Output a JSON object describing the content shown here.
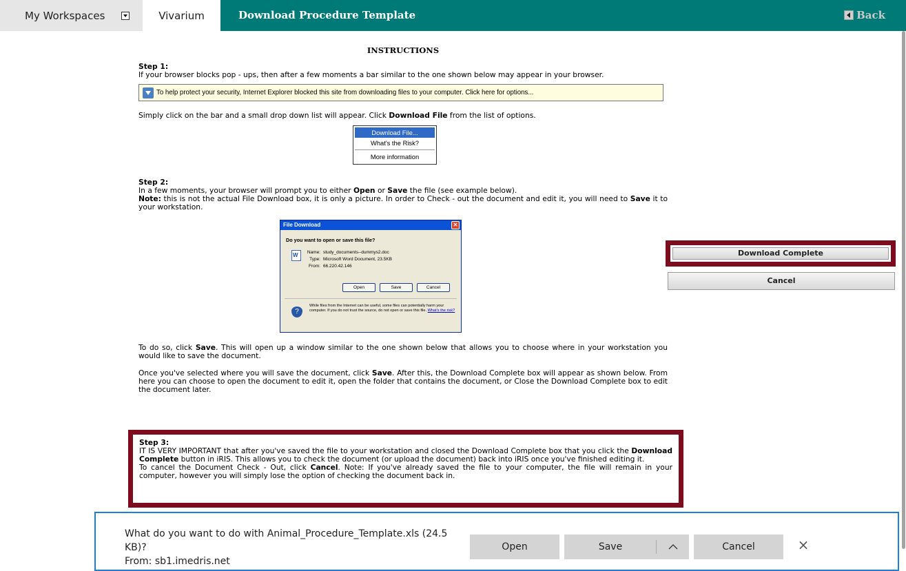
{
  "nav": {
    "workspaces_label": "My Workspaces",
    "vivarium_label": "Vivarium",
    "page_title": "Download Procedure Template",
    "back_label": "Back"
  },
  "instructions": {
    "heading": "INSTRUCTIONS",
    "step1_title": "Step 1:",
    "step1_text": "If your browser blocks pop - ups, then after a few moments a bar similar to the one shown below may appear in your browser.",
    "ie_bar_text": "To help protect your security, Internet Explorer blocked this site from downloading files to your computer. Click here for options...",
    "after_bar_pre": "Simply click on the bar and a small drop down list will appear. Click ",
    "after_bar_bold": "Download File",
    "after_bar_post": " from the list of options.",
    "dropdown": [
      "Download File...",
      "What's the Risk?",
      "More information"
    ],
    "step2_title": "Step 2:",
    "step2_pre": "In a few moments, your browser will prompt you to either ",
    "step2_open": "Open",
    "step2_or": " or ",
    "step2_save": "Save",
    "step2_post": " the file (see example below).",
    "note_label": "Note:",
    "note_text": " this is not the actual File Download box, it is only a picture. In order to Check - out the document and edit it, you will need to ",
    "note_save": "Save",
    "note_post": " it to your workstation.",
    "todo_pre": "To do so, click ",
    "todo_save": "Save",
    "todo_post": ". This will open up a window similar to the one shown below that allows you to choose where in your workstation you would like to save the document.",
    "once_pre": "Once you've selected where you will save the document, click ",
    "once_save": "Save",
    "once_post": ". After this, the Download Complete box will appear as shown below. From here you can choose to open the document to edit it, open the folder that contains the document, or Close the Download Complete box to edit the document later.",
    "step3_title": "Step 3:",
    "step3_pre": "IT IS VERY IMPORTANT that after you've saved the file to your workstation and closed the Download Complete box that you click the ",
    "step3_bold": "Download Complete",
    "step3_post": " button in iRIS. This allows you to check the document (or upload the document) back into iRIS once you've finished editing it.",
    "cancel_pre": "To cancel the Document Check - Out, click ",
    "cancel_bold": "Cancel",
    "cancel_post": ". Note: If you've already saved the file to your computer, the file will remain in your computer, however you will simply lose the option of checking the document back in."
  },
  "file_dialog": {
    "title": "File Download",
    "question": "Do you want to open or save this file?",
    "name_label": "Name:",
    "name_value": "study_documents--dummys2.doc",
    "type_label": "Type:",
    "type_value": "Microsoft Word Document, 23.5KB",
    "from_label": "From:",
    "from_value": "66.220.42.146",
    "btn_open": "Open",
    "btn_save": "Save",
    "btn_cancel": "Cancel",
    "warning": "While files from the Internet can be useful, some files can potentially harm your computer. If you do not trust the source, do not open or save this file. ",
    "risk_link": "What's the risk?"
  },
  "side_buttons": {
    "download_complete": "Download Complete",
    "cancel": "Cancel"
  },
  "download_bar": {
    "question": "What do you want to do with Animal_Procedure_Template.xls (24.5 KB)?",
    "from": "From: sb1.imedris.net",
    "open": "Open",
    "save": "Save",
    "cancel": "Cancel",
    "chevron": "^",
    "close": "×"
  },
  "colors": {
    "header_teal": "#007a76",
    "highlight_maroon": "#7d0c1f",
    "download_bar_border": "#1b7fd6"
  }
}
